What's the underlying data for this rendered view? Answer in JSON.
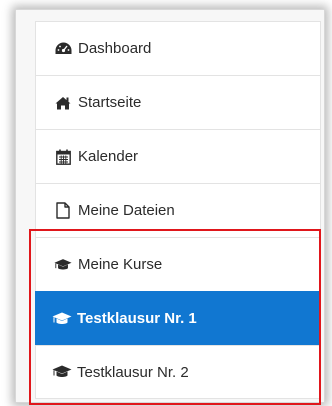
{
  "nav": {
    "items": [
      {
        "label": "Dashboard",
        "icon": "dashboard-icon"
      },
      {
        "label": "Startseite",
        "icon": "home-icon"
      },
      {
        "label": "Kalender",
        "icon": "calendar-icon"
      },
      {
        "label": "Meine Dateien",
        "icon": "file-icon"
      },
      {
        "label": "Meine Kurse",
        "icon": "graduation-cap-icon"
      },
      {
        "label": "Testklausur Nr. 1",
        "icon": "graduation-cap-icon",
        "active": true
      },
      {
        "label": "Testklausur Nr. 2",
        "icon": "graduation-cap-icon"
      }
    ]
  },
  "colors": {
    "active_bg": "#1177d1",
    "highlight_border": "#e0161b",
    "text": "#2b2b2b"
  }
}
